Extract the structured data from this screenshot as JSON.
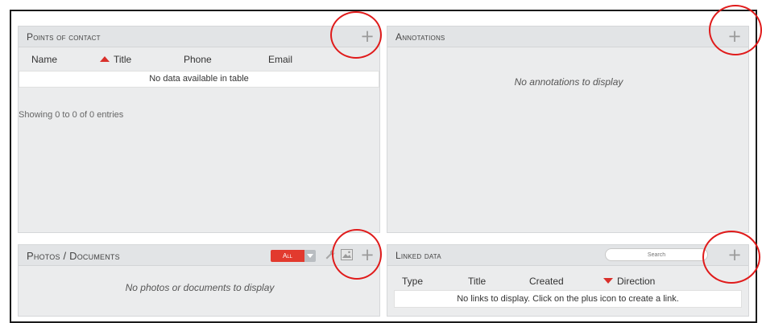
{
  "contacts": {
    "title": "Points of contact",
    "add_label": "+",
    "columns": [
      "Name",
      "Title",
      "Phone",
      "Email"
    ],
    "empty_message": "No data available in table",
    "showing": "Showing 0 to 0 of 0 entries"
  },
  "annotations": {
    "title": "Annotations",
    "add_label": "+",
    "empty_message": "No annotations to display"
  },
  "photos": {
    "title": "Photos / Documents",
    "filter_label": "All",
    "add_label": "+",
    "empty_message": "No photos or documents to display"
  },
  "linked": {
    "title": "Linked data",
    "search_placeholder": "Search",
    "add_label": "+",
    "columns": [
      "Type",
      "Title",
      "Created",
      "Direction"
    ],
    "empty_message": "No links to display. Click on the plus icon to create a link."
  },
  "colors": {
    "highlight": "#e01b1b",
    "badge": "#e23a2e",
    "sort_arrow": "#d9302b"
  },
  "icons": [
    "plus-icon",
    "wrench-icon",
    "image-icon",
    "chevron-down-icon",
    "sort-asc-icon",
    "sort-desc-icon"
  ]
}
